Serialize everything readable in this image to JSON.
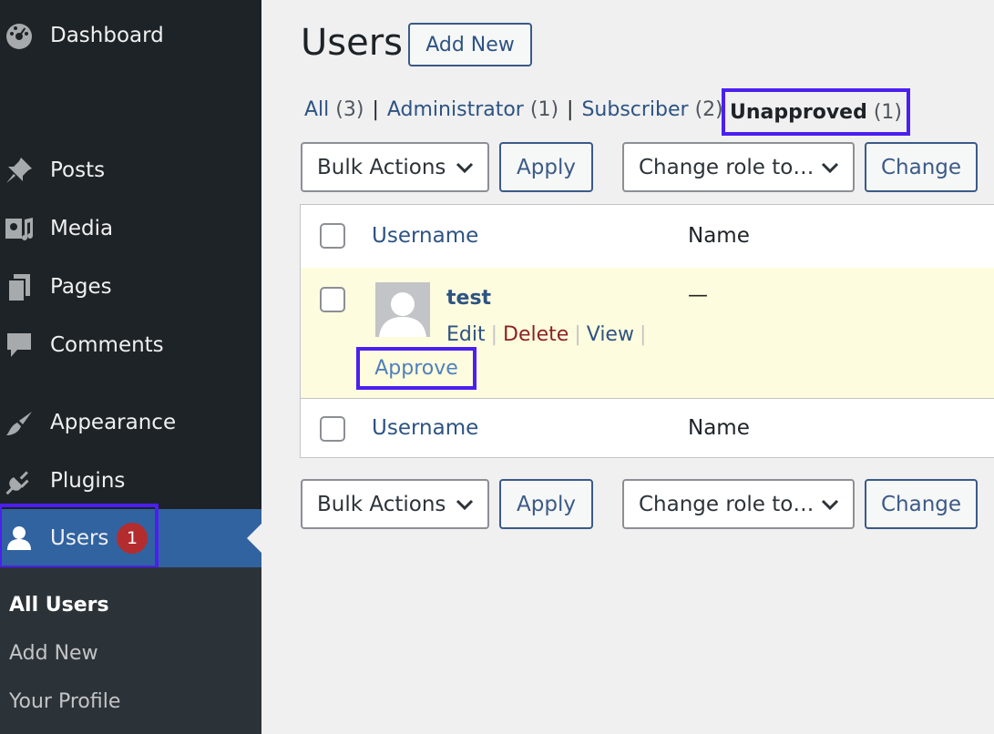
{
  "sidebar": {
    "items": [
      {
        "label": "Dashboard",
        "icon": "dashboard-icon"
      },
      {
        "label": "Posts",
        "icon": "pin-icon"
      },
      {
        "label": "Media",
        "icon": "media-icon"
      },
      {
        "label": "Pages",
        "icon": "pages-icon"
      },
      {
        "label": "Comments",
        "icon": "comment-icon"
      },
      {
        "label": "Appearance",
        "icon": "brush-icon"
      },
      {
        "label": "Plugins",
        "icon": "plug-icon"
      },
      {
        "label": "Users",
        "icon": "user-icon",
        "badge": "1"
      }
    ],
    "submenu": [
      "All Users",
      "Add New",
      "Your Profile"
    ]
  },
  "header": {
    "title": "Users",
    "add_new": "Add New"
  },
  "views": {
    "all": "All",
    "all_count": "(3)",
    "administrator": "Administrator",
    "administrator_count": "(1)",
    "subscriber": "Subscriber",
    "subscriber_count": "(2)",
    "unapproved": "Unapproved",
    "unapproved_count": "(1)",
    "separator": "|"
  },
  "toolbar": {
    "bulk_actions": "Bulk Actions",
    "apply": "Apply",
    "change_role": "Change role to…",
    "change": "Change"
  },
  "table": {
    "columns": [
      "Username",
      "Name"
    ],
    "rows": [
      {
        "username": "test",
        "name": "—",
        "actions": [
          "Edit",
          "Delete",
          "View",
          "Approve"
        ]
      }
    ]
  },
  "colors": {
    "sidebar_bg": "#1d2327",
    "active_bg": "#3163a0",
    "highlight": "#4b1ff0",
    "link": "#2d5383",
    "row_highlight": "#fefcde",
    "badge": "#b32d2e"
  }
}
